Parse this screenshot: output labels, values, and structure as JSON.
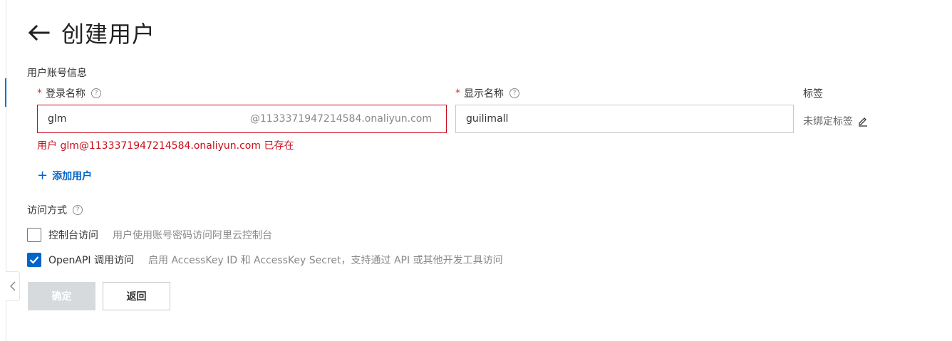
{
  "header": {
    "title": "创建用户",
    "back_icon": "arrow-left-icon"
  },
  "section": {
    "title": "用户账号信息"
  },
  "fields": {
    "login_name": {
      "label": "登录名称",
      "required_mark": "*",
      "value": "glm",
      "suffix": "@1133371947214584.onaliyun.com",
      "error": "用户 glm@1133371947214584.onaliyun.com 已存在"
    },
    "display_name": {
      "label": "显示名称",
      "required_mark": "*",
      "value": "guilimall"
    },
    "tags": {
      "label": "标签",
      "value": "未绑定标签"
    }
  },
  "add_user": {
    "label": "添加用户",
    "icon": "+"
  },
  "access": {
    "title": "访问方式",
    "options": [
      {
        "label": "控制台访问",
        "description": "用户使用账号密码访问阿里云控制台",
        "checked": false
      },
      {
        "label": "OpenAPI 调用访问",
        "description": "启用 AccessKey ID 和 AccessKey Secret，支持通过 API 或其他开发工具访问",
        "checked": true
      }
    ]
  },
  "buttons": {
    "confirm": "确定",
    "back": "返回"
  },
  "help_icon": "?",
  "colors": {
    "accent": "#0064c8",
    "error": "#c80d1c",
    "disabled_bg": "#d7dadd"
  }
}
